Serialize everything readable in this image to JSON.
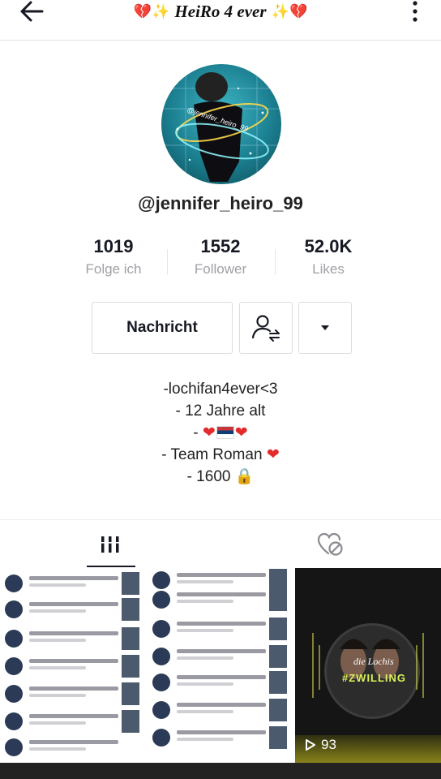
{
  "header": {
    "title": "HeiRo 4 ever",
    "deco_left": "💔✨",
    "deco_right": "✨💔"
  },
  "profile": {
    "handle": "@jennifer_heiro_99",
    "avatar_watermark": "@jennifer_heiro_99"
  },
  "stats": [
    {
      "value": "1019",
      "label": "Folge ich"
    },
    {
      "value": "1552",
      "label": "Follower"
    },
    {
      "value": "52.0K",
      "label": "Likes"
    }
  ],
  "actions": {
    "message_label": "Nachricht"
  },
  "bio": {
    "line1": "-lochifan4ever<3",
    "line2": "- 12 Jahre alt",
    "line3_prefix": "-",
    "line3_hearts": "❤",
    "line4": "- Team Roman",
    "line4_heart": "❤",
    "line5": "-  1600",
    "line5_icon": "🔒"
  },
  "tabs": [
    {
      "name": "videos-grid",
      "active": true
    },
    {
      "name": "liked-private",
      "active": false
    }
  ],
  "videos": [
    {
      "type": "screenshot-list"
    },
    {
      "type": "screenshot-list"
    },
    {
      "type": "video",
      "brand": "die Lochis",
      "label": "#ZWILLING",
      "play_count": "93"
    }
  ],
  "colors": {
    "accent_heart": "#e32b2b",
    "text_primary": "#161823",
    "text_secondary": "#a0a0a6"
  }
}
